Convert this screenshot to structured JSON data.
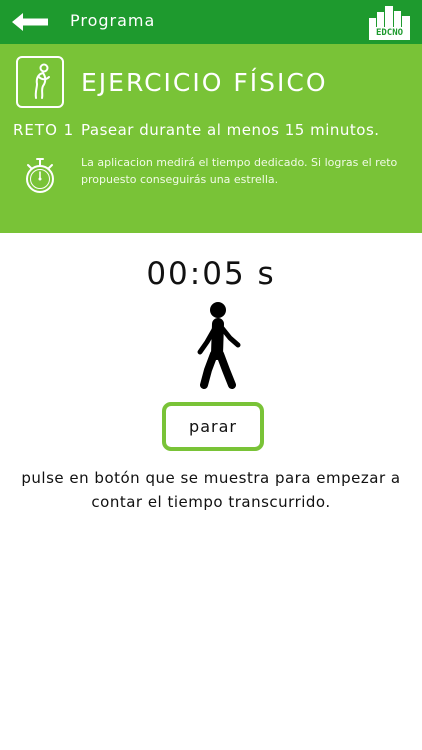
{
  "topbar": {
    "title": "Programa",
    "back_icon": "arrow-left-icon",
    "logo_text": "EDCNO",
    "color": "#1e9a2e"
  },
  "header": {
    "title": "EJERCICIO FÍSICO",
    "reto_label": "RETO 1",
    "reto_text": "Pasear durante al menos 15 minutos.",
    "info": "La aplicacion medirá el tiempo dedicado. Si logras el reto propuesto conseguirás una estrella.",
    "exercise_icon": "exercise-person-icon",
    "timer_icon": "stopwatch-icon",
    "color": "#79c337"
  },
  "timer": {
    "display": "00:05 s",
    "walker_icon": "walking-person-icon"
  },
  "controls": {
    "stop_label": "parar",
    "border_color": "#79c337"
  },
  "instructions": "pulse en botón que se muestra para empezar a contar el tiempo transcurrido."
}
